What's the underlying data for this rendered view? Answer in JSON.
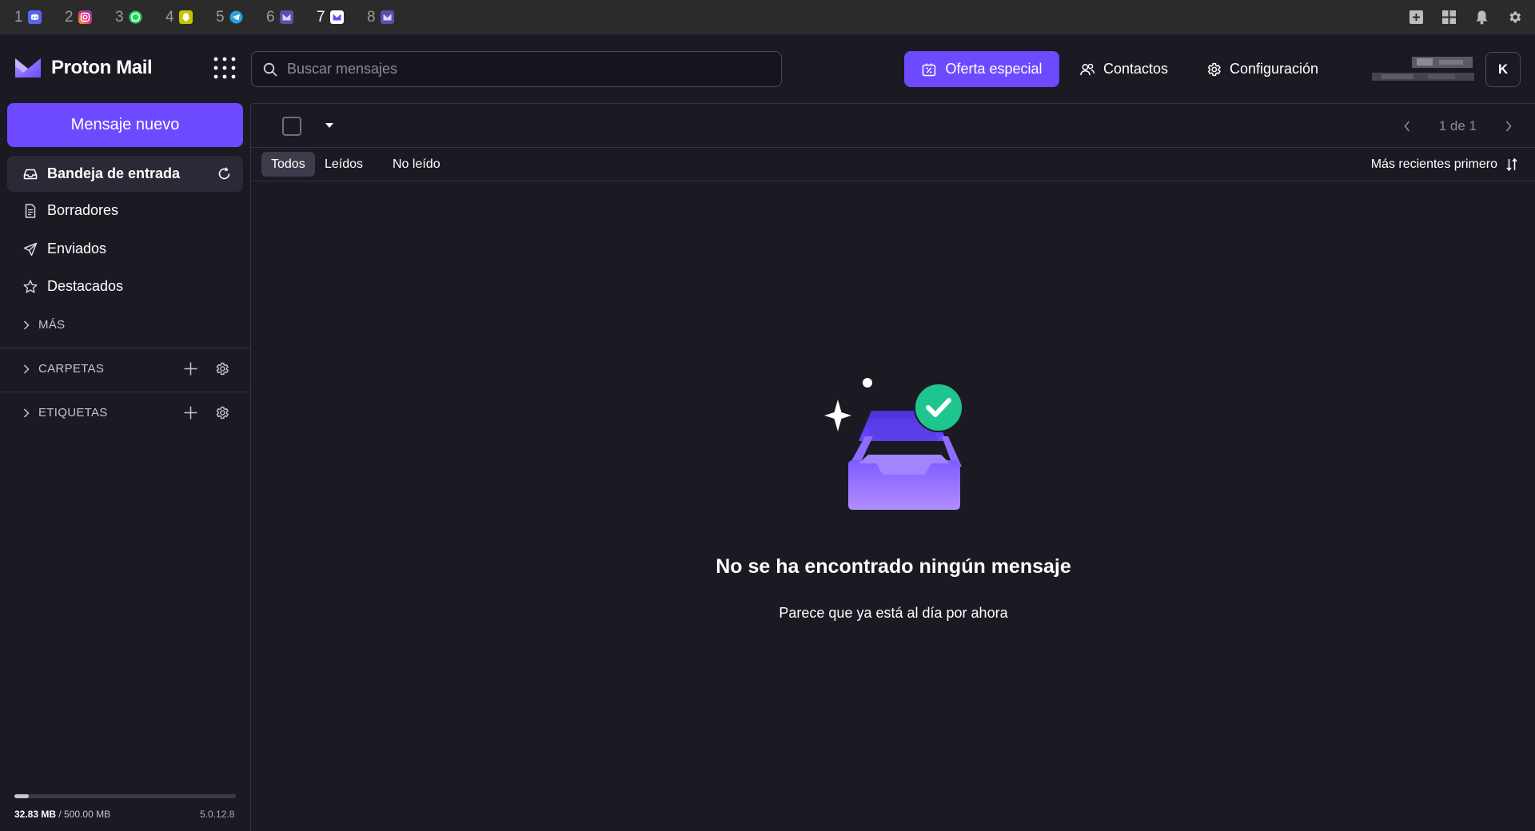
{
  "os_bar": {
    "workspaces": [
      {
        "num": "1",
        "app": "discord-icon",
        "color": "#5865f2"
      },
      {
        "num": "2",
        "app": "instagram-icon",
        "color": "#e1306c"
      },
      {
        "num": "3",
        "app": "whatsapp-icon",
        "color": "#25d366"
      },
      {
        "num": "4",
        "app": "snapchat-icon",
        "color": "#fffc00"
      },
      {
        "num": "5",
        "app": "telegram-icon",
        "color": "#2aa1da"
      },
      {
        "num": "6",
        "app": "proton-mail-icon",
        "color": "#6d4aff"
      },
      {
        "num": "7",
        "app": "proton-mail-icon",
        "color": "#6d4aff"
      },
      {
        "num": "8",
        "app": "proton-mail-icon",
        "color": "#6d4aff"
      }
    ],
    "active_workspace": "7",
    "tray_icons": [
      "add-square-icon",
      "grid-icon",
      "bell-icon",
      "gear-icon"
    ]
  },
  "header": {
    "brand": "Proton Mail",
    "search_placeholder": "Buscar mensajes",
    "offer_label": "Oferta especial",
    "contacts_label": "Contactos",
    "settings_label": "Configuración",
    "avatar_initial": "K"
  },
  "sidebar": {
    "compose_label": "Mensaje nuevo",
    "items": [
      {
        "label": "Bandeja de entrada",
        "icon": "inbox-icon",
        "active": true
      },
      {
        "label": "Borradores",
        "icon": "draft-icon",
        "active": false
      },
      {
        "label": "Enviados",
        "icon": "paper-plane-icon",
        "active": false
      },
      {
        "label": "Destacados",
        "icon": "star-icon",
        "active": false
      }
    ],
    "more_label": "MÁS",
    "folders_label": "CARPETAS",
    "labels_label": "ETIQUETAS",
    "storage_used": "32.83 MB",
    "storage_total": "/ 500.00 MB",
    "storage_fraction": 0.066,
    "version": "5.0.12.8"
  },
  "mailbox": {
    "pagination": "1 de 1",
    "filters": [
      "Todos",
      "Leídos",
      "No leído"
    ],
    "active_filter": "Todos",
    "sort_label": "Más recientes primero",
    "empty_title": "No se ha encontrado ningún mensaje",
    "empty_subtitle": "Parece que ya está al día por ahora"
  },
  "colors": {
    "accent": "#6d4aff",
    "background": "#1b1a23",
    "success": "#1ec58e"
  }
}
